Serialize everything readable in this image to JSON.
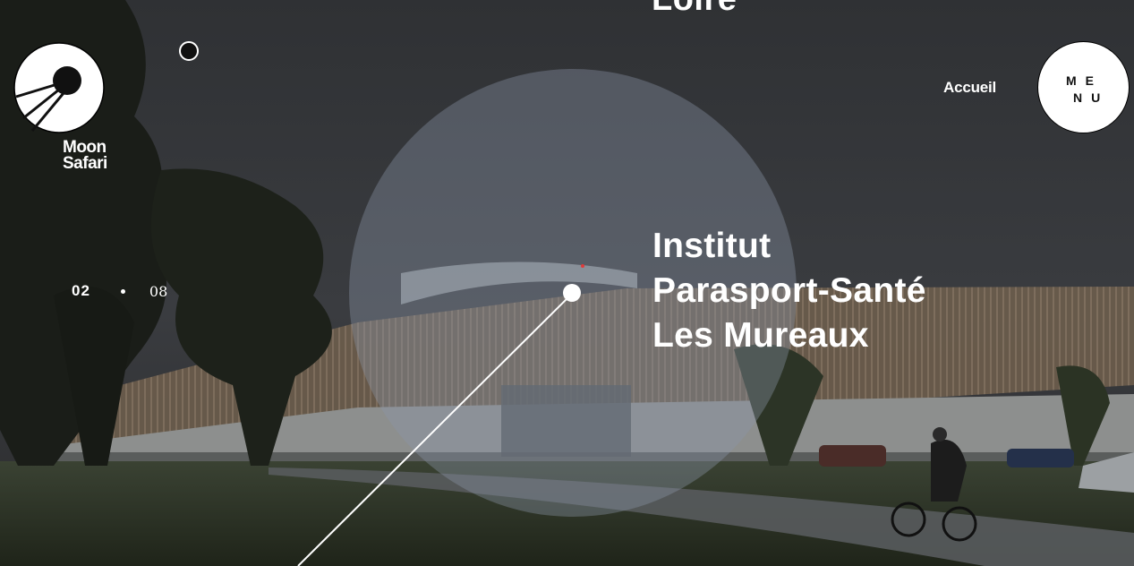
{
  "brand": {
    "name_line1": "Moon",
    "name_line2": "Safari"
  },
  "header": {
    "home_link": "Accueil",
    "menu_line1": "ME",
    "menu_line2": "NU"
  },
  "slider": {
    "current": "02",
    "total": "08",
    "previous_title": "Loire",
    "title_lines": [
      "Institut",
      "Parasport-Santé",
      "Les Mureaux"
    ]
  },
  "icons": {
    "logo": "sputnik-satellite-logo-icon",
    "cursor": "cursor-circle-icon"
  },
  "colors": {
    "accent": "#ffffff",
    "menu_bg": "#ffffff",
    "lens_overlay": "#8b96a8"
  }
}
